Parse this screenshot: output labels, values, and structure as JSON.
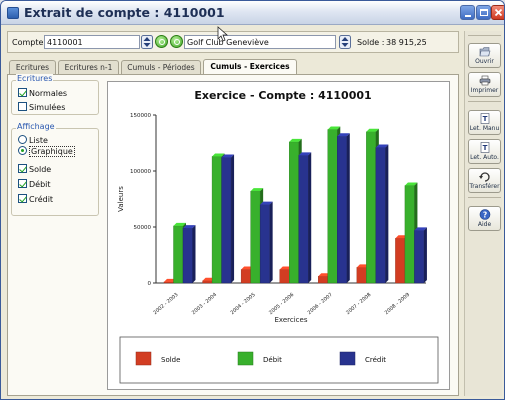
{
  "window": {
    "title": "Extrait de compte : 4110001"
  },
  "search": {
    "compte_label": "Compte",
    "compte_value": "4110001",
    "client_value": "Golf Club Geneviève",
    "solde_label": "Solde :",
    "solde_value": "38 915,25"
  },
  "tabs": [
    {
      "label": "Ecritures",
      "active": false
    },
    {
      "label": "Ecritures n-1",
      "active": false
    },
    {
      "label": "Cumuls - Périodes",
      "active": false
    },
    {
      "label": "Cumuls - Exercices",
      "active": true
    }
  ],
  "ecritures_group": {
    "title": "Ecritures",
    "items": [
      {
        "label": "Normales",
        "checked": true
      },
      {
        "label": "Simulées",
        "checked": false
      }
    ]
  },
  "affichage_group": {
    "title": "Affichage",
    "radios": [
      {
        "label": "Liste",
        "checked": false
      },
      {
        "label": "Graphique",
        "checked": true
      }
    ],
    "checks": [
      {
        "label": "Solde",
        "checked": true
      },
      {
        "label": "Débit",
        "checked": true
      },
      {
        "label": "Crédit",
        "checked": true
      }
    ]
  },
  "toolbar": [
    {
      "label": "Ouvrir",
      "icon": "open-icon"
    },
    {
      "label": "Imprimer",
      "icon": "printer-icon"
    },
    {
      "label": "Let. Manu",
      "icon": "manual-lettering-icon"
    },
    {
      "label": "Let. Auto.",
      "icon": "auto-lettering-icon"
    },
    {
      "label": "Transférer",
      "icon": "transfer-icon"
    },
    {
      "label": "Aide",
      "icon": "help-icon"
    }
  ],
  "colors": {
    "solde": "#d23d22",
    "debit": "#38b02c",
    "credit": "#28338f"
  },
  "chart_data": {
    "type": "bar",
    "title": "Exercice - Compte : 4110001",
    "xlabel": "Exercices",
    "ylabel": "Valeurs",
    "ylim": [
      0,
      150000
    ],
    "yticks": [
      "0",
      "50000",
      "100000",
      "150000"
    ],
    "categories": [
      "2002 - 2003",
      "2003 - 2004",
      "2004 - 2005",
      "2005 - 2006",
      "2006 - 2007",
      "2007 - 2008",
      "2008 - 2009"
    ],
    "series": [
      {
        "name": "Solde",
        "values": [
          1000,
          2000,
          12000,
          12000,
          6000,
          14000,
          40000
        ]
      },
      {
        "name": "Débit",
        "values": [
          51000,
          113000,
          82000,
          126000,
          137000,
          135000,
          87000
        ]
      },
      {
        "name": "Crédit",
        "values": [
          49000,
          112000,
          70000,
          114000,
          131000,
          121000,
          47000
        ]
      }
    ],
    "grid": false,
    "legend_position": "bottom"
  }
}
